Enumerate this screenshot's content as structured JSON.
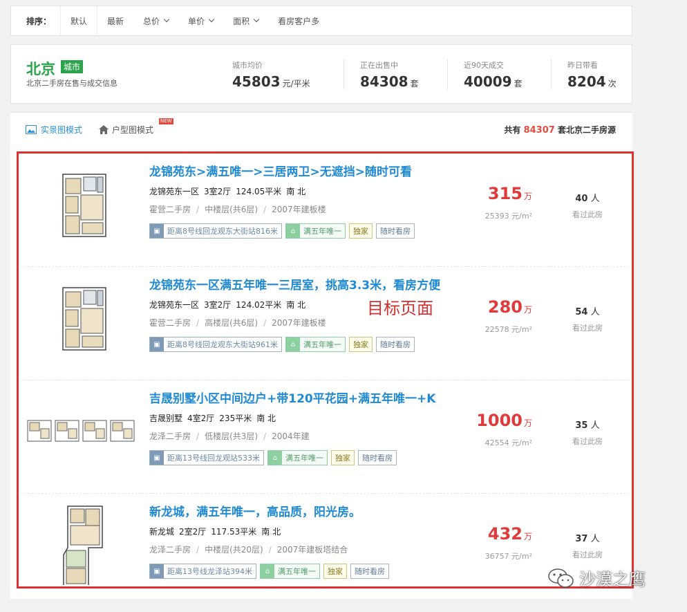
{
  "sort": {
    "label": "排序：",
    "items": [
      {
        "label": "默认",
        "active": true
      },
      {
        "label": "最新"
      },
      {
        "label": "总价",
        "chevron": true
      },
      {
        "label": "单价",
        "chevron": true
      },
      {
        "label": "面积",
        "chevron": true
      },
      {
        "label": "看房客户多"
      }
    ]
  },
  "city": {
    "name": "北京",
    "badge": "城市",
    "subtitle": "北京二手房在售与成交信息",
    "stats": [
      {
        "label": "城市均价",
        "value": "45803",
        "unit": "元/平米"
      },
      {
        "label": "正在出售中",
        "value": "84308",
        "unit": "套"
      },
      {
        "label": "近90天成交",
        "value": "40009",
        "unit": "套"
      },
      {
        "label": "昨日带看",
        "value": "8204",
        "unit": "次"
      }
    ]
  },
  "mode": {
    "photo_label": "实景图模式",
    "plan_label": "户型图模式",
    "new_badge": "NEW",
    "total_prefix": "共有",
    "total_count": "84307",
    "total_suffix": "套北京二手房源"
  },
  "listings": [
    {
      "title": "龙锦苑东>满五唯一>三居两卫>无遮挡>随时可看",
      "community": "龙锦苑东一区",
      "layout": "3室2厅",
      "area": "124.05平米",
      "orientation": "南 北",
      "district": "霍营二手房",
      "floor": "中楼层(共6层)",
      "built": "2007年建板楼",
      "subway": "距离8号线回龙观东大街站816米",
      "tax": "满五年唯一",
      "exclusive": "独家",
      "viewing": "随时看房",
      "price": "315",
      "price_unit": "万",
      "unit_price": "25393 元/m²",
      "viewers": "40",
      "viewers_unit": "人",
      "viewers_label": "看过此房"
    },
    {
      "title": "龙锦苑东一区满五年唯一三居室，挑高3.3米，看房方便",
      "community": "龙锦苑东一区",
      "layout": "3室2厅",
      "area": "124.02平米",
      "orientation": "南 北",
      "district": "霍营二手房",
      "floor": "高楼层(共6层)",
      "built": "2007年建板楼",
      "subway": "距离8号线回龙观东大街站961米",
      "tax": "满五年唯一",
      "exclusive": "独家",
      "viewing": "随时看房",
      "price": "280",
      "price_unit": "万",
      "unit_price": "22578 元/m²",
      "viewers": "54",
      "viewers_unit": "人",
      "viewers_label": "看过此房"
    },
    {
      "title": "吉晟别墅小区中间边户+带120平花园+满五年唯一+K",
      "community": "吉晟别墅",
      "layout": "4室2厅",
      "area": "235平米",
      "orientation": "南 北",
      "district": "龙泽二手房",
      "floor": "低楼层(共3层)",
      "built": "2004年建",
      "subway": "距离13号线回龙观站533米",
      "tax": "满五年唯一",
      "exclusive": "独家",
      "viewing": "随时看房",
      "price": "1000",
      "price_unit": "万",
      "unit_price": "42554 元/m²",
      "viewers": "35",
      "viewers_unit": "人",
      "viewers_label": "看过此房"
    },
    {
      "title": "新龙城，满五年唯一，高品质，阳光房。",
      "community": "新龙城",
      "layout": "2室2厅",
      "area": "117.53平米",
      "orientation": "南 北",
      "district": "龙泽二手房",
      "floor": "中楼层(共20层)",
      "built": "2007年建板塔结合",
      "subway": "距离13号线龙泽站394米",
      "tax": "满五年唯一",
      "exclusive": "独家",
      "viewing": "随时看房",
      "price": "432",
      "price_unit": "万",
      "unit_price": "36757 元/m²",
      "viewers": "37",
      "viewers_unit": "人",
      "viewers_label": "看过此房"
    }
  ],
  "annotation": "目标页面",
  "watermark": "沙漠之鹰",
  "colors": {
    "accent": "#1f8ad2",
    "price": "#e03a3a",
    "city": "#2aa34a",
    "frame": "#e03030"
  }
}
